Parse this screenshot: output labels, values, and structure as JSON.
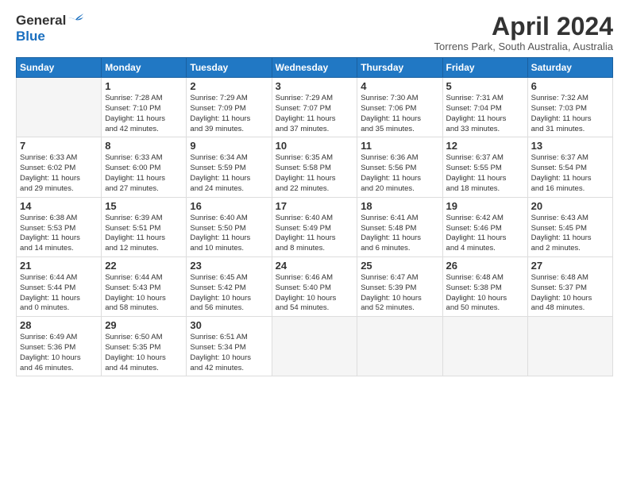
{
  "logo": {
    "general": "General",
    "blue": "Blue"
  },
  "title": "April 2024",
  "subtitle": "Torrens Park, South Australia, Australia",
  "headers": [
    "Sunday",
    "Monday",
    "Tuesday",
    "Wednesday",
    "Thursday",
    "Friday",
    "Saturday"
  ],
  "weeks": [
    [
      {
        "num": "",
        "info": ""
      },
      {
        "num": "1",
        "info": "Sunrise: 7:28 AM\nSunset: 7:10 PM\nDaylight: 11 hours\nand 42 minutes."
      },
      {
        "num": "2",
        "info": "Sunrise: 7:29 AM\nSunset: 7:09 PM\nDaylight: 11 hours\nand 39 minutes."
      },
      {
        "num": "3",
        "info": "Sunrise: 7:29 AM\nSunset: 7:07 PM\nDaylight: 11 hours\nand 37 minutes."
      },
      {
        "num": "4",
        "info": "Sunrise: 7:30 AM\nSunset: 7:06 PM\nDaylight: 11 hours\nand 35 minutes."
      },
      {
        "num": "5",
        "info": "Sunrise: 7:31 AM\nSunset: 7:04 PM\nDaylight: 11 hours\nand 33 minutes."
      },
      {
        "num": "6",
        "info": "Sunrise: 7:32 AM\nSunset: 7:03 PM\nDaylight: 11 hours\nand 31 minutes."
      }
    ],
    [
      {
        "num": "7",
        "info": "Sunrise: 6:33 AM\nSunset: 6:02 PM\nDaylight: 11 hours\nand 29 minutes."
      },
      {
        "num": "8",
        "info": "Sunrise: 6:33 AM\nSunset: 6:00 PM\nDaylight: 11 hours\nand 27 minutes."
      },
      {
        "num": "9",
        "info": "Sunrise: 6:34 AM\nSunset: 5:59 PM\nDaylight: 11 hours\nand 24 minutes."
      },
      {
        "num": "10",
        "info": "Sunrise: 6:35 AM\nSunset: 5:58 PM\nDaylight: 11 hours\nand 22 minutes."
      },
      {
        "num": "11",
        "info": "Sunrise: 6:36 AM\nSunset: 5:56 PM\nDaylight: 11 hours\nand 20 minutes."
      },
      {
        "num": "12",
        "info": "Sunrise: 6:37 AM\nSunset: 5:55 PM\nDaylight: 11 hours\nand 18 minutes."
      },
      {
        "num": "13",
        "info": "Sunrise: 6:37 AM\nSunset: 5:54 PM\nDaylight: 11 hours\nand 16 minutes."
      }
    ],
    [
      {
        "num": "14",
        "info": "Sunrise: 6:38 AM\nSunset: 5:53 PM\nDaylight: 11 hours\nand 14 minutes."
      },
      {
        "num": "15",
        "info": "Sunrise: 6:39 AM\nSunset: 5:51 PM\nDaylight: 11 hours\nand 12 minutes."
      },
      {
        "num": "16",
        "info": "Sunrise: 6:40 AM\nSunset: 5:50 PM\nDaylight: 11 hours\nand 10 minutes."
      },
      {
        "num": "17",
        "info": "Sunrise: 6:40 AM\nSunset: 5:49 PM\nDaylight: 11 hours\nand 8 minutes."
      },
      {
        "num": "18",
        "info": "Sunrise: 6:41 AM\nSunset: 5:48 PM\nDaylight: 11 hours\nand 6 minutes."
      },
      {
        "num": "19",
        "info": "Sunrise: 6:42 AM\nSunset: 5:46 PM\nDaylight: 11 hours\nand 4 minutes."
      },
      {
        "num": "20",
        "info": "Sunrise: 6:43 AM\nSunset: 5:45 PM\nDaylight: 11 hours\nand 2 minutes."
      }
    ],
    [
      {
        "num": "21",
        "info": "Sunrise: 6:44 AM\nSunset: 5:44 PM\nDaylight: 11 hours\nand 0 minutes."
      },
      {
        "num": "22",
        "info": "Sunrise: 6:44 AM\nSunset: 5:43 PM\nDaylight: 10 hours\nand 58 minutes."
      },
      {
        "num": "23",
        "info": "Sunrise: 6:45 AM\nSunset: 5:42 PM\nDaylight: 10 hours\nand 56 minutes."
      },
      {
        "num": "24",
        "info": "Sunrise: 6:46 AM\nSunset: 5:40 PM\nDaylight: 10 hours\nand 54 minutes."
      },
      {
        "num": "25",
        "info": "Sunrise: 6:47 AM\nSunset: 5:39 PM\nDaylight: 10 hours\nand 52 minutes."
      },
      {
        "num": "26",
        "info": "Sunrise: 6:48 AM\nSunset: 5:38 PM\nDaylight: 10 hours\nand 50 minutes."
      },
      {
        "num": "27",
        "info": "Sunrise: 6:48 AM\nSunset: 5:37 PM\nDaylight: 10 hours\nand 48 minutes."
      }
    ],
    [
      {
        "num": "28",
        "info": "Sunrise: 6:49 AM\nSunset: 5:36 PM\nDaylight: 10 hours\nand 46 minutes."
      },
      {
        "num": "29",
        "info": "Sunrise: 6:50 AM\nSunset: 5:35 PM\nDaylight: 10 hours\nand 44 minutes."
      },
      {
        "num": "30",
        "info": "Sunrise: 6:51 AM\nSunset: 5:34 PM\nDaylight: 10 hours\nand 42 minutes."
      },
      {
        "num": "",
        "info": ""
      },
      {
        "num": "",
        "info": ""
      },
      {
        "num": "",
        "info": ""
      },
      {
        "num": "",
        "info": ""
      }
    ]
  ]
}
